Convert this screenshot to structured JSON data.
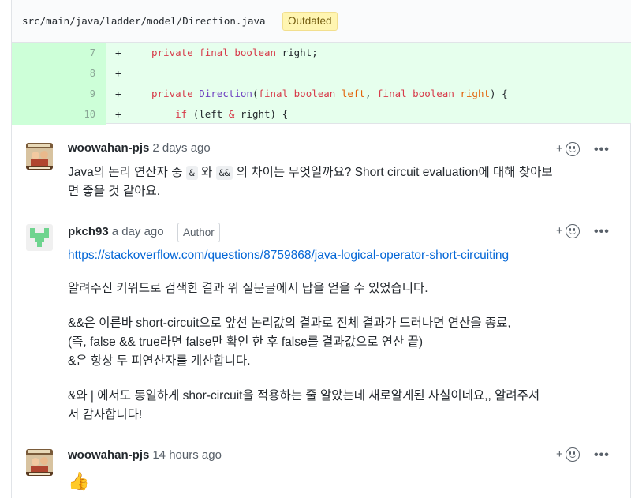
{
  "file": {
    "path": "src/main/java/ladder/model/Direction.java",
    "badge": "Outdated"
  },
  "diff": {
    "lines": [
      {
        "num": "7",
        "sign": "+",
        "indent": "",
        "tokens": [
          [
            "kw",
            "private final boolean "
          ],
          [
            "t",
            "right;"
          ]
        ]
      },
      {
        "num": "8",
        "sign": "+",
        "indent": "",
        "tokens": []
      },
      {
        "num": "9",
        "sign": "+",
        "indent": "",
        "tokens": [
          [
            "kw",
            "private "
          ],
          [
            "fn",
            "Direction"
          ],
          [
            "t",
            "("
          ],
          [
            "kw",
            "final boolean "
          ],
          [
            "ar",
            "left"
          ],
          [
            "t",
            ", "
          ],
          [
            "kw",
            "final boolean "
          ],
          [
            "ar",
            "right"
          ],
          [
            "t",
            ") {"
          ]
        ]
      },
      {
        "num": "10",
        "sign": "+",
        "indent": "    ",
        "tokens": [
          [
            "kw",
            "if "
          ],
          [
            "t",
            "(left "
          ],
          [
            "kw",
            "& "
          ],
          [
            "t",
            "right) {"
          ]
        ]
      }
    ]
  },
  "comments": [
    {
      "author": "woowahan-pjs",
      "time": "2 days ago",
      "body_parts": [
        "Java의 논리 연산자 중 ",
        "&",
        " 와 ",
        "&&",
        " 의 차이는 무엇일까요? Short circuit evaluation에 대해 찾아보",
        "면 좋을 것 같아요."
      ]
    },
    {
      "author": "pkch93",
      "time": "a day ago",
      "badge": "Author",
      "link": "https://stackoverflow.com/questions/8759868/java-logical-operator-short-circuiting",
      "paragraphs": [
        [
          "알려주신 키워드로 검색한 결과 위 질문글에서 답을 얻을 수 있었습니다."
        ],
        [
          "&&은 이른바 short-circuit으로 앞선 논리값의 결과로 전체 결과가 드러나면 연산을 종료,",
          "(즉, false && true라면 false만 확인 한 후 false를 결과값으로 연산 끝)",
          "&은 항상 두 피연산자를 계산합니다."
        ],
        [
          "&와 | 에서도 동일하게 shor-circuit을 적용하는 줄 알았는데 새로알게된 사실이네요,, 알려주셔",
          "서 감사합니다!"
        ]
      ]
    },
    {
      "author": "woowahan-pjs",
      "time": "14 hours ago",
      "body": "👍"
    }
  ],
  "actions": {
    "reaction_plus": "+",
    "more": "•••"
  },
  "icons": [
    "smiley-icon",
    "kebab-icon",
    "avatar-woowahan",
    "avatar-pkch93"
  ]
}
